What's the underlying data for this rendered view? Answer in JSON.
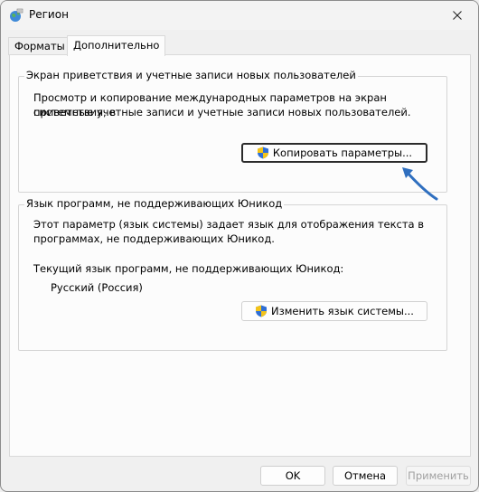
{
  "window": {
    "title": "Регион"
  },
  "tabs": [
    {
      "label": "Форматы",
      "active": false
    },
    {
      "label": "Дополнительно",
      "active": true
    }
  ],
  "welcome_group": {
    "title": "Экран приветствия и учетные записи новых пользователей",
    "description_line1": "Просмотр и копирование международных параметров на экран приветствия, в",
    "description_line2": "системные учетные записи и учетные записи новых пользователей.",
    "copy_button_label": "Копировать параметры..."
  },
  "nonunicode_group": {
    "title": "Язык программ, не поддерживающих Юникод",
    "description_line1": "Этот параметр (язык системы) задает язык для отображения текста в",
    "description_line2": "программах, не поддерживающих Юникод.",
    "current_label": "Текущий язык программ, не поддерживающих Юникод:",
    "current_value": "Русский (Россия)",
    "change_button_label": "Изменить язык системы..."
  },
  "dialog_buttons": {
    "ok": "OK",
    "cancel": "Отмена",
    "apply": "Применить"
  },
  "colors": {
    "annotation_arrow": "#2f6fbf",
    "shield_blue": "#2f6fd6",
    "shield_yellow": "#f3c318"
  }
}
